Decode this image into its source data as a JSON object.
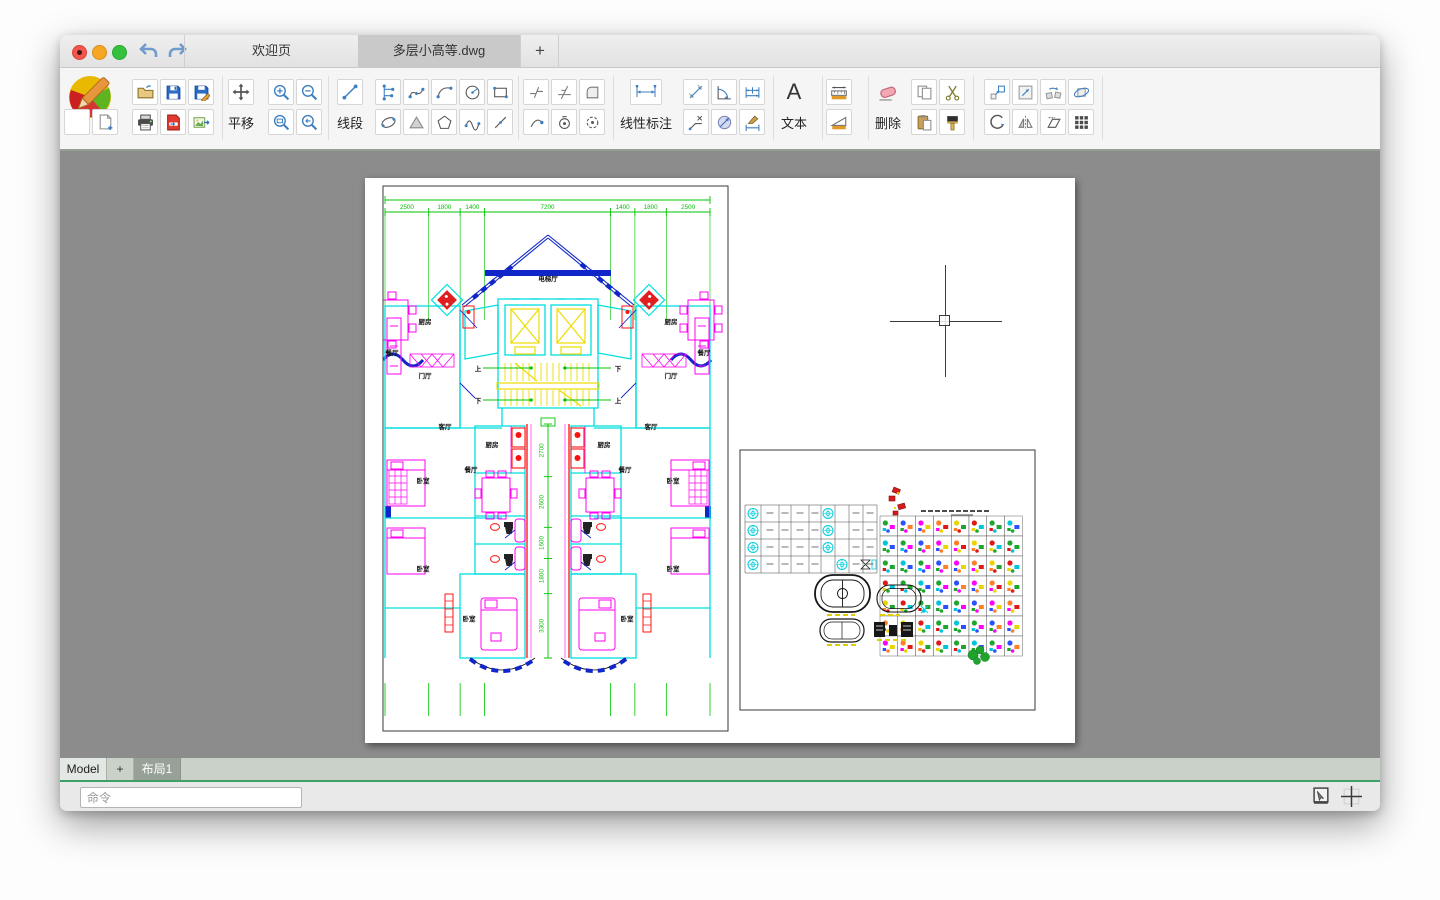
{
  "titlebar": {
    "tabs": [
      {
        "label": "欢迎页",
        "active": false
      },
      {
        "label": "多层小高等.dwg",
        "active": true
      }
    ],
    "new_tab_label": "+"
  },
  "toolbar": {
    "pan_label": "平移",
    "line_label": "线段",
    "linear_dim_label": "线性标注",
    "text_label": "文本",
    "delete_label": "删除",
    "text_icon_letter": "A"
  },
  "drawing": {
    "top_dims": [
      2500,
      1800,
      1400,
      7200,
      1400,
      1800,
      2500
    ],
    "center_dims": [
      2700,
      2600,
      1600,
      1800,
      3300
    ],
    "labels": {
      "elevator_hall": "电梯厅",
      "kitchen": "厨房",
      "dining": "餐厅",
      "foyer": "门厅",
      "living": "客厅",
      "bedroom": "卧室",
      "up": "上",
      "down": "下"
    },
    "colors": {
      "wall": "#00dede",
      "furniture": "#ff00f0",
      "dims": "#00c300",
      "core": "#ecdc00",
      "roof": "#1026c8",
      "accent": "#ff1111"
    },
    "palette": [
      "#1ea62c",
      "#e01818",
      "#ff00ff",
      "#00c3dd",
      "#e8d500",
      "#2b50ff",
      "#1ea62c",
      "#ff7f27"
    ]
  },
  "layout_tabs": {
    "model": "Model",
    "add": "+",
    "layout1": "布局1"
  },
  "command": {
    "placeholder": "命令"
  }
}
